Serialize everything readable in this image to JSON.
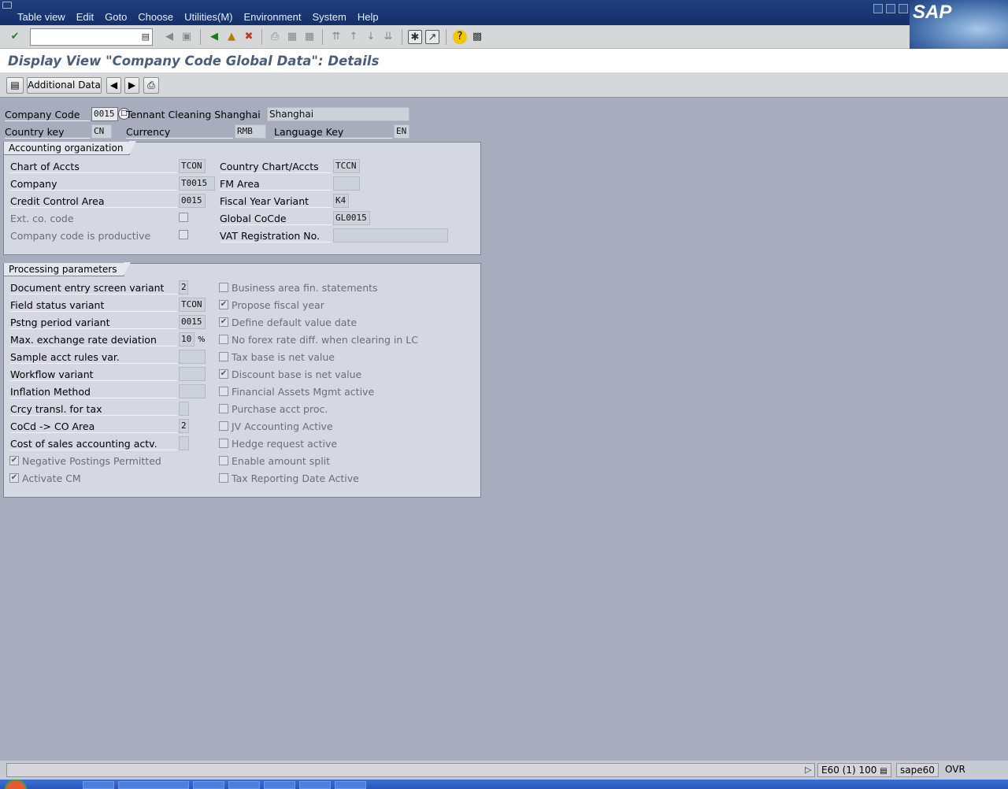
{
  "menu": [
    "Table view",
    "Edit",
    "Goto",
    "Choose",
    "Utilities(M)",
    "Environment",
    "System",
    "Help"
  ],
  "logo": "SAP",
  "title": "Display View \"Company Code Global Data\": Details",
  "app_toolbar": {
    "additional_data": "Additional Data"
  },
  "header": {
    "company_code_label": "Company Code",
    "company_code": "0015",
    "company_name": "Tennant Cleaning Shanghai",
    "city": "Shanghai",
    "country_key_label": "Country key",
    "country_key": "CN",
    "currency_label": "Currency",
    "currency": "RMB",
    "language_key_label": "Language Key",
    "language_key": "EN"
  },
  "accounting_org": {
    "title": "Accounting organization",
    "chart_of_accts_label": "Chart of Accts",
    "chart_of_accts": "TCON",
    "company_label": "Company",
    "company": "T0015",
    "credit_control_label": "Credit Control Area",
    "credit_control": "0015",
    "ext_co_code_label": "Ext. co. code",
    "productive_label": "Company code is productive",
    "country_chart_label": "Country Chart/Accts",
    "country_chart": "TCCN",
    "fm_area_label": "FM Area",
    "fm_area": "",
    "fy_variant_label": "Fiscal Year Variant",
    "fy_variant": "K4",
    "global_cocde_label": "Global CoCde",
    "global_cocde": "GL0015",
    "vat_label": "VAT Registration No.",
    "vat": ""
  },
  "processing": {
    "title": "Processing parameters",
    "rows": [
      {
        "label": "Document entry screen variant",
        "value": "2"
      },
      {
        "label": "Field status variant",
        "value": "TCON"
      },
      {
        "label": "Pstng period variant",
        "value": "0015"
      },
      {
        "label": "Max. exchange rate deviation",
        "value": "10",
        "unit": "%"
      },
      {
        "label": "Sample acct rules var.",
        "value": ""
      },
      {
        "label": "Workflow variant",
        "value": ""
      },
      {
        "label": "Inflation Method",
        "value": ""
      },
      {
        "label": "Crcy transl. for tax",
        "value": ""
      },
      {
        "label": "CoCd -> CO Area",
        "value": "2"
      },
      {
        "label": "Cost of sales accounting actv.",
        "value": ""
      }
    ],
    "left_checks": [
      {
        "label": "Negative Postings Permitted",
        "checked": true
      },
      {
        "label": "Activate CM",
        "checked": true
      }
    ],
    "right_checks": [
      {
        "label": "Business area fin. statements",
        "checked": false
      },
      {
        "label": "Propose fiscal year",
        "checked": true
      },
      {
        "label": "Define default value date",
        "checked": true
      },
      {
        "label": "No forex rate diff. when clearing in LC",
        "checked": false
      },
      {
        "label": "Tax base is net value",
        "checked": false
      },
      {
        "label": "Discount base is net value",
        "checked": true
      },
      {
        "label": "Financial Assets Mgmt active",
        "checked": false
      },
      {
        "label": "Purchase acct proc.",
        "checked": false
      },
      {
        "label": "JV Accounting Active",
        "checked": false
      },
      {
        "label": "Hedge request active",
        "checked": false
      },
      {
        "label": "Enable amount split",
        "checked": false
      },
      {
        "label": "Tax Reporting Date Active",
        "checked": false
      }
    ]
  },
  "status": {
    "system": "E60 (1) 100",
    "host": "sape60",
    "mode": "OVR"
  }
}
